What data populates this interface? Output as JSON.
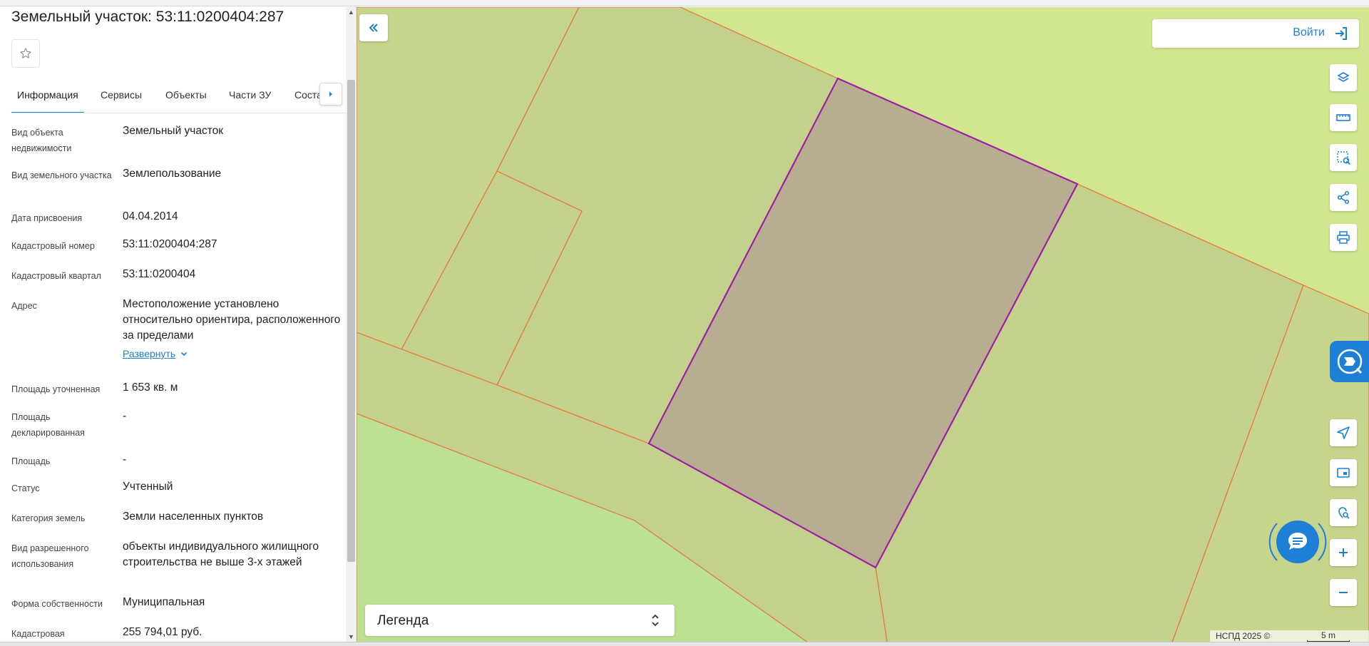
{
  "panel": {
    "title": "Земельный участок: 53:11:0200404:287",
    "favorite_icon": "star-outline-icon",
    "tabs": [
      {
        "label": "Информация",
        "active": true
      },
      {
        "label": "Сервисы",
        "active": false
      },
      {
        "label": "Объекты",
        "active": false
      },
      {
        "label": "Части ЗУ",
        "active": false
      },
      {
        "label": "Соста",
        "active": false
      }
    ],
    "tab_scroll_icon": "caret-right-icon",
    "rows": [
      {
        "label": "Вид объекта недвижимости",
        "value": "Земельный участок"
      },
      {
        "label": "Вид земельного участка",
        "value": "Землепользование"
      },
      {
        "label": "Дата присвоения",
        "value": "04.04.2014"
      },
      {
        "label": "Кадастровый номер",
        "value": "53:11:0200404:287"
      },
      {
        "label": "Кадастровый квартал",
        "value": "53:11:0200404"
      },
      {
        "label": "Адрес",
        "value": "Местоположение установлено относительно ориентира, расположенного за пределами"
      },
      {
        "label": "Площадь уточненная",
        "value": "1 653 кв. м"
      },
      {
        "label": "Площадь декларированная",
        "value": "-"
      },
      {
        "label": "Площадь",
        "value": "-"
      },
      {
        "label": "Статус",
        "value": "Учтенный"
      },
      {
        "label": "Категория земель",
        "value": "Земли населенных пунктов"
      },
      {
        "label": "Вид разрешенного использования",
        "value": "объекты индивидуального жилищного строительства не выше 3-х этажей"
      },
      {
        "label": "Форма собственности",
        "value": "Муниципальная"
      },
      {
        "label": "Кадастровая",
        "value": "255 794,01 руб."
      }
    ],
    "expand_label": "Развернуть"
  },
  "map": {
    "collapse_icon": "double-chevron-left-icon",
    "login_label": "Войти",
    "login_icon": "login-arrow-icon",
    "legend_label": "Легенда",
    "legend_icon": "chevron-up-down-icon",
    "copyright": "НСПД 2025 ©",
    "scale_label": "5 m",
    "tools": [
      "layers-icon",
      "ruler-icon",
      "select-area-icon",
      "share-icon",
      "print-icon",
      "locate-arrow-icon",
      "minimap-icon",
      "location-search-icon",
      "zoom-in-icon",
      "zoom-out-icon"
    ],
    "brand_icon": "nspd-logo-icon",
    "chat_icon": "chat-bubble-icon",
    "colors": {
      "background": "#d2e690",
      "parcel_fill": "#c3d18d",
      "selected_fill": "#b9ad91",
      "green_area": "#bde193",
      "boundary": "#e8743c",
      "selected_boundary": "#9c1fa3",
      "accent": "#1e7fd6"
    }
  }
}
